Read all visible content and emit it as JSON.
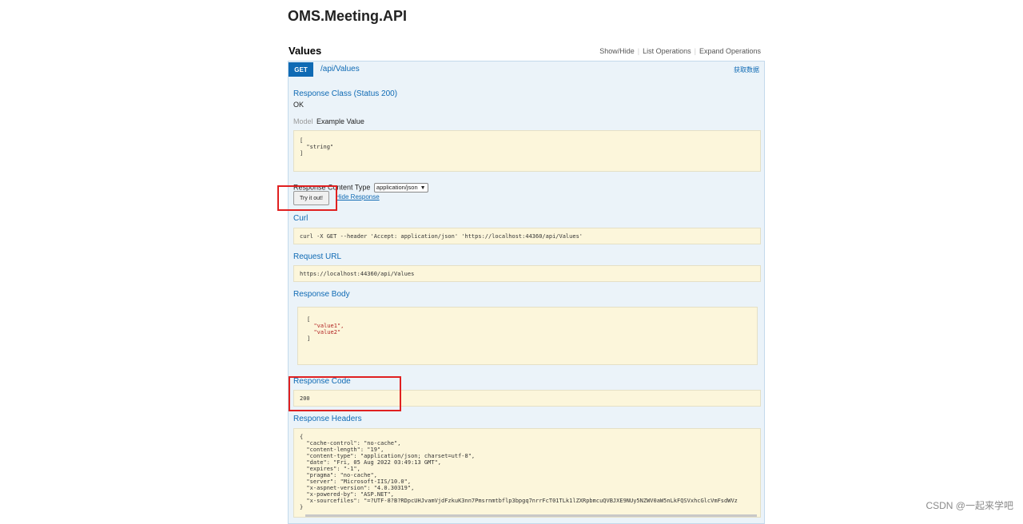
{
  "page": {
    "title": "OMS.Meeting.API"
  },
  "resource": {
    "name": "Values",
    "ops": {
      "show_hide": "Show/Hide",
      "list": "List Operations",
      "expand": "Expand Operations"
    }
  },
  "operation": {
    "method": "GET",
    "path": "/api/Values",
    "summary": "获取数据",
    "response_class_heading": "Response Class (Status 200)",
    "response_class_value": "OK",
    "model_tab": "Model",
    "example_tab": "Example Value",
    "example_lines": [
      "[",
      "  \"string\"",
      "]"
    ],
    "content_type_label": "Response Content Type",
    "content_type_value": "application/json",
    "try_button": "Try it out!",
    "hide_response": "Hide Response",
    "curl_heading": "Curl",
    "curl_value": "curl -X GET --header 'Accept: application/json' 'https://localhost:44360/api/Values'",
    "request_url_heading": "Request URL",
    "request_url_value": "https://localhost:44360/api/Values",
    "response_body_heading": "Response Body",
    "response_body": {
      "open": "[",
      "items": [
        "\"value1\",",
        "\"value2\""
      ],
      "close": "]"
    },
    "response_code_heading": "Response Code",
    "response_code_value": "200",
    "response_headers_heading": "Response Headers",
    "response_headers_lines": [
      "{",
      "  \"cache-control\": \"no-cache\",",
      "  \"content-length\": \"19\",",
      "  \"content-type\": \"application/json; charset=utf-8\",",
      "  \"date\": \"Fri, 05 Aug 2022 03:49:13 GMT\",",
      "  \"expires\": \"-1\",",
      "  \"pragma\": \"no-cache\",",
      "  \"server\": \"Microsoft-IIS/10.0\",",
      "  \"x-aspnet-version\": \"4.0.30319\",",
      "  \"x-powered-by\": \"ASP.NET\",",
      "  \"x-sourcefiles\": \"=?UTF-8?B?RDpcUHJvamVjdFzkuK3nn7Pmsrnmtbflp3bpgq7nrrFcT01TLk1lZXRpbmcuQVBJXE9NUy5NZWV0aW5nLkFQSVxhcGlcVmFsdWVz",
      "}"
    ]
  },
  "watermark": "CSDN @一起来学吧",
  "colors": {
    "accent": "#0f6ab4",
    "operation_bg": "#ebf3f9",
    "code_bg": "#fcf6db",
    "highlight": "#e02020"
  }
}
